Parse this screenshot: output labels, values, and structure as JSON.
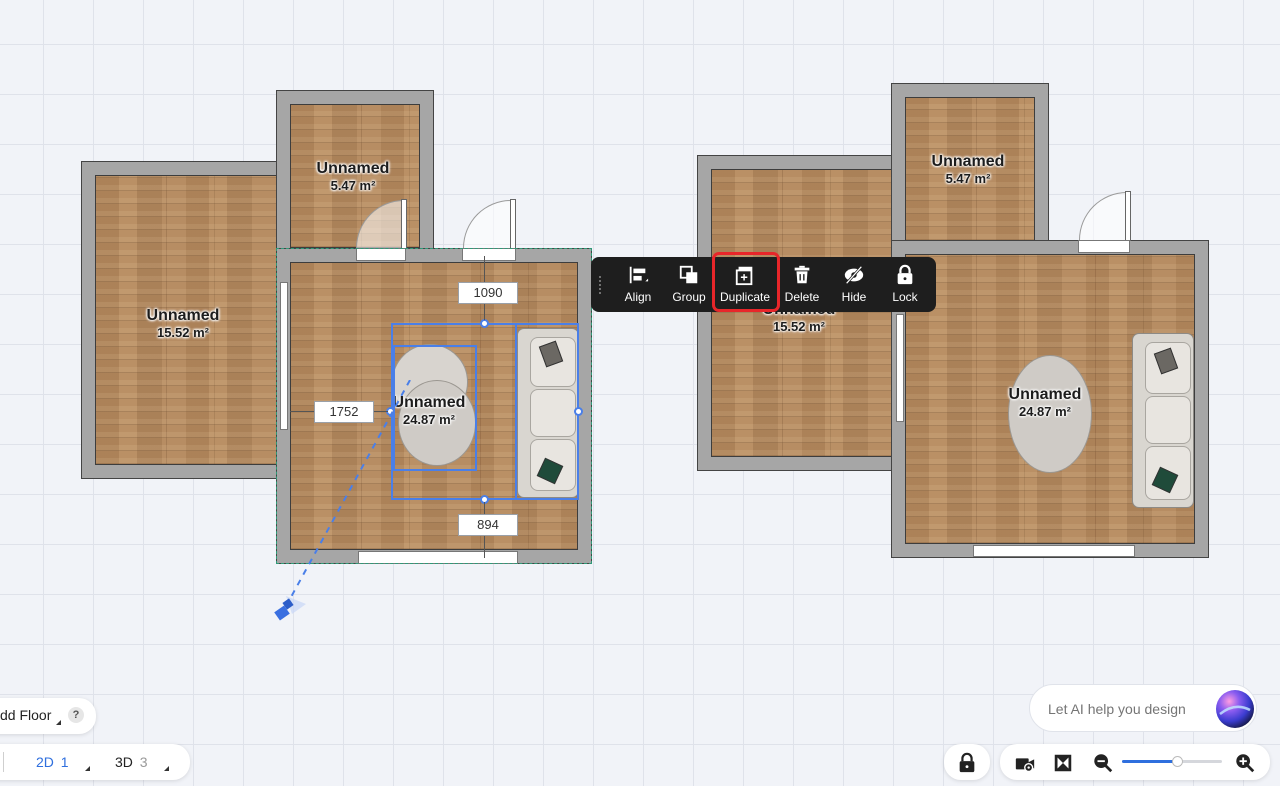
{
  "left_plan": {
    "rooms": [
      {
        "name": "Unnamed",
        "area": "5.47 m²"
      },
      {
        "name": "Unnamed",
        "area": "15.52 m²"
      },
      {
        "name": "Unnamed",
        "area": "24.87 m²"
      }
    ],
    "dimensions": {
      "top": "1090",
      "left": "1752",
      "bottom": "894"
    }
  },
  "right_plan": {
    "rooms": [
      {
        "name": "Unnamed",
        "area": "5.47 m²"
      },
      {
        "name": "Unnamed",
        "area": "15.52 m²"
      },
      {
        "name": "Unnamed",
        "area": "24.87 m²"
      }
    ]
  },
  "toolbar": {
    "items": [
      {
        "label": "Align",
        "icon": "align-icon"
      },
      {
        "label": "Group",
        "icon": "group-icon"
      },
      {
        "label": "Duplicate",
        "icon": "duplicate-icon",
        "highlighted": true
      },
      {
        "label": "Delete",
        "icon": "trash-icon"
      },
      {
        "label": "Hide",
        "icon": "eye-off-icon"
      },
      {
        "label": "Lock",
        "icon": "lock-icon"
      }
    ]
  },
  "floor_panel": {
    "add_floor_label": "dd Floor",
    "help": "?"
  },
  "view_switch": {
    "twod_label": "2D",
    "twod_count": "1",
    "threed_label": "3D",
    "threed_count": "3"
  },
  "ai_assistant": {
    "placeholder": "Let AI help you design"
  },
  "zoom": {
    "level": 0.55
  },
  "colors": {
    "accent": "#2f6fde",
    "highlight": "#e8262a",
    "selection": "#4a7fe8",
    "toolbar_bg": "#1e1e1e"
  }
}
